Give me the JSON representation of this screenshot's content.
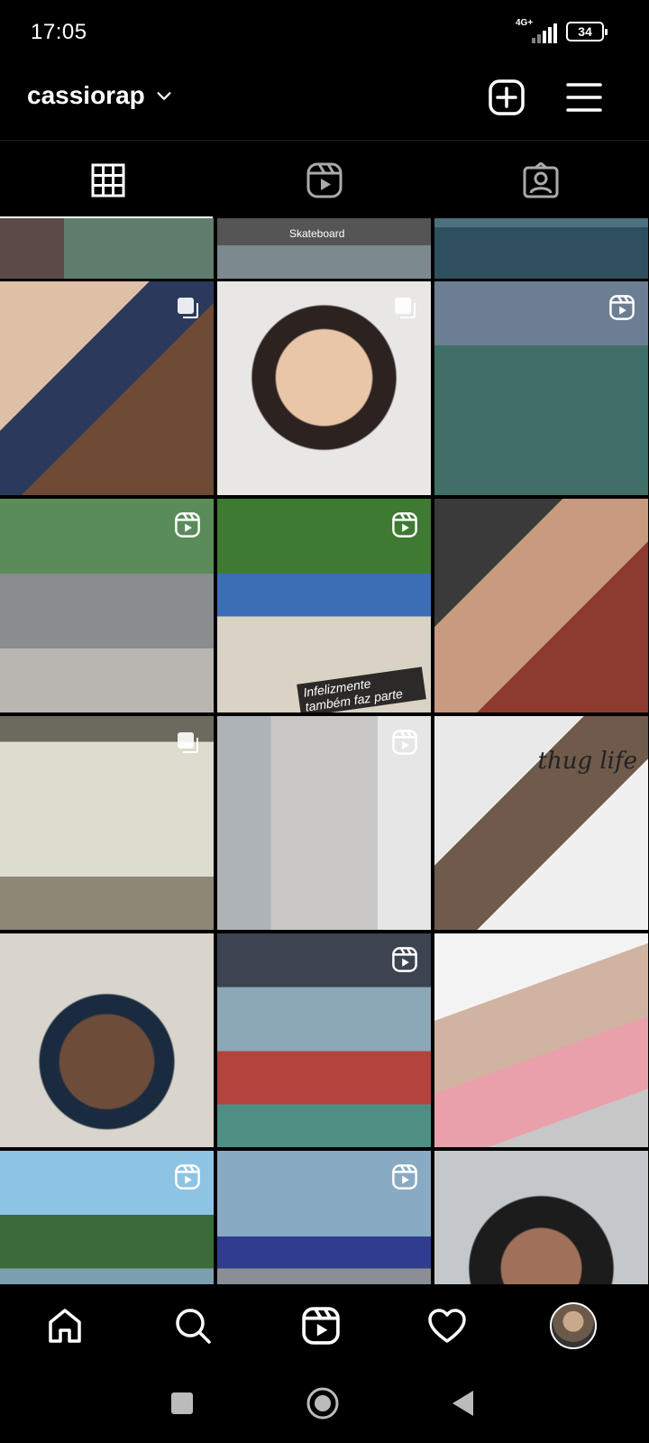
{
  "status": {
    "time": "17:05",
    "network": "4G+",
    "battery": "34"
  },
  "header": {
    "username": "cassiorap"
  },
  "tabs": [
    "grid",
    "reels",
    "tagged"
  ],
  "grid": {
    "captions": {
      "skateboard": "Skateboard",
      "infelizmente": "Infelizmente também faz parte",
      "thug": "thug life"
    }
  },
  "bottom_nav": [
    "home",
    "search",
    "reels",
    "activity",
    "profile"
  ]
}
